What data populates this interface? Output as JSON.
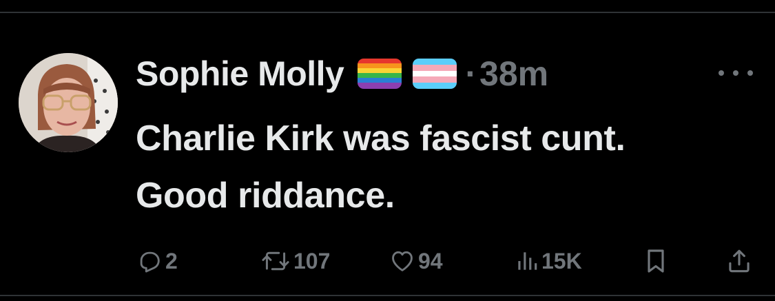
{
  "tweet": {
    "author_name": "Sophie Molly",
    "badges": [
      "rainbow-flag-icon",
      "transgender-flag-icon"
    ],
    "separator": "·",
    "timestamp": "38m",
    "text_line1": "Charlie Kirk was fascist cunt.",
    "text_line2": "Good riddance."
  },
  "actions": {
    "replies": "2",
    "reposts": "107",
    "likes": "94",
    "views": "15K"
  },
  "colors": {
    "background": "#000000",
    "primary_text": "#e7e9ea",
    "secondary_text": "#71767b",
    "divider": "#2f3336"
  }
}
